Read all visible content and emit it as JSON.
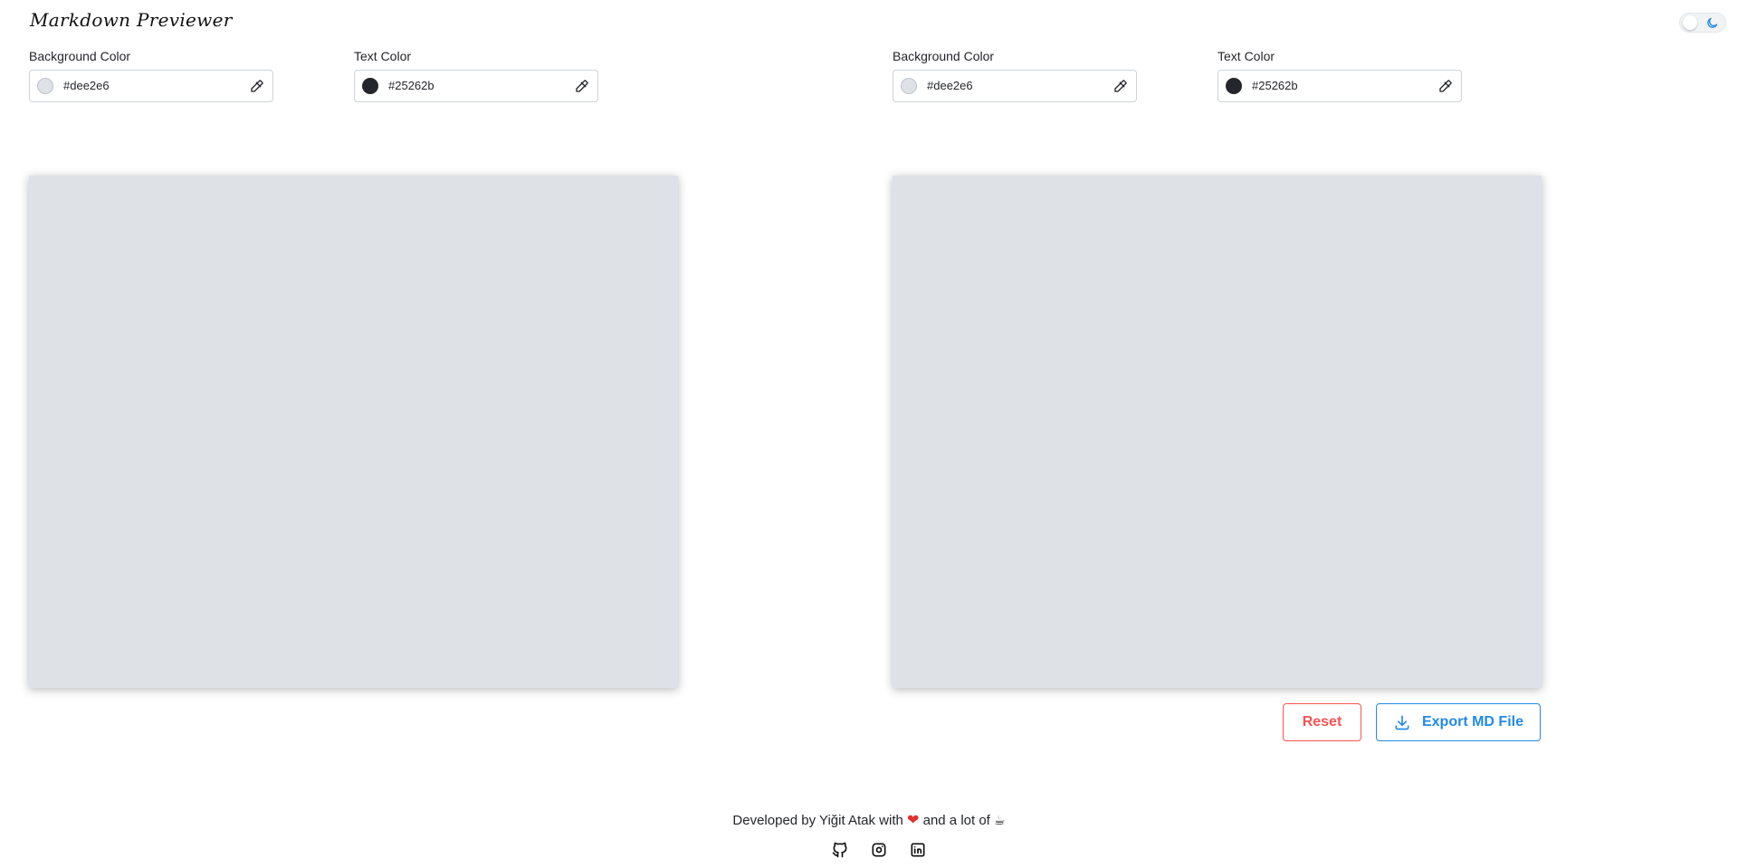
{
  "app": {
    "title": "Markdown Previewer"
  },
  "editor_colors": {
    "background": {
      "label": "Background Color",
      "value": "#dee2e6",
      "swatch": "#dee2e6"
    },
    "text": {
      "label": "Text Color",
      "value": "#25262b",
      "swatch": "#25262b"
    }
  },
  "preview_colors": {
    "background": {
      "label": "Background Color",
      "value": "#dee2e6",
      "swatch": "#dee2e6"
    },
    "text": {
      "label": "Text Color",
      "value": "#25262b",
      "swatch": "#25262b"
    }
  },
  "editor": {
    "content": ""
  },
  "actions": {
    "reset_label": "Reset",
    "export_label": "Export MD File"
  },
  "footer": {
    "prefix": "Developed by Yiğit Atak with",
    "heart": "❤",
    "middle": "and a lot of",
    "coffee": "☕"
  },
  "social": [
    "github-icon",
    "instagram-icon",
    "linkedin-icon"
  ],
  "colors": {
    "reset": "#fa5252",
    "export": "#228be6",
    "panel_bg": "#dee2e6",
    "toggle_accent": "#228be6"
  }
}
